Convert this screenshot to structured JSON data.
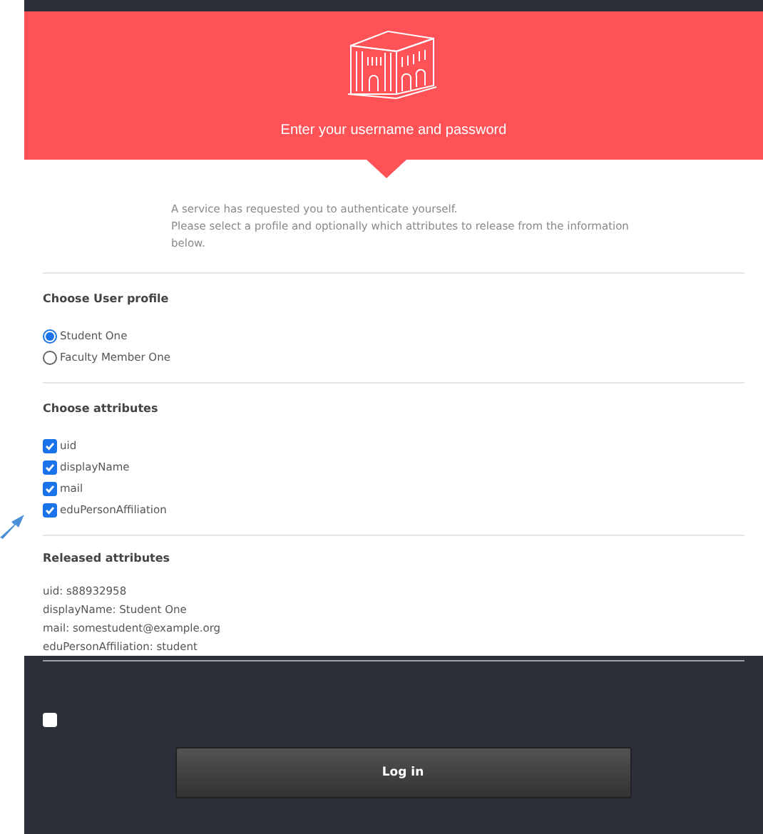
{
  "header": {
    "title": "Enter your username and password"
  },
  "intro": [
    "A service has requested you to authenticate yourself.",
    "Please select a profile and optionally which attributes to release from the information below."
  ],
  "profile": {
    "heading": "Choose User profile",
    "options": [
      {
        "label": "Student One",
        "selected": true
      },
      {
        "label": "Faculty Member One",
        "selected": false
      }
    ]
  },
  "attributes": {
    "heading": "Choose attributes",
    "items": [
      {
        "label": "uid",
        "checked": true
      },
      {
        "label": "displayName",
        "checked": true
      },
      {
        "label": "mail",
        "checked": true
      },
      {
        "label": "eduPersonAffiliation",
        "checked": true
      }
    ]
  },
  "released": {
    "heading": "Released attributes",
    "lines": [
      "uid: s88932958",
      "displayName: Student One",
      "mail: somestudent@example.org",
      "eduPersonAffiliation: student"
    ]
  },
  "footer": {
    "remember": {
      "checked": false
    },
    "button": "Log in"
  }
}
